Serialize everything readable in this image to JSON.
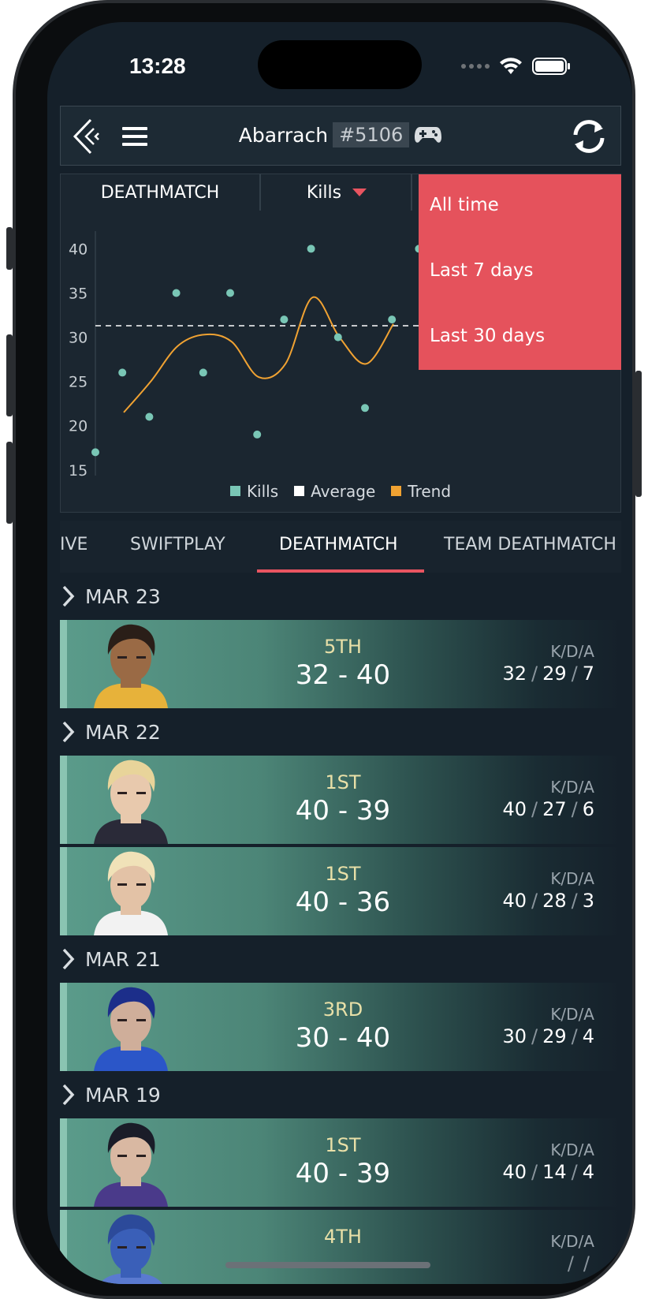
{
  "status": {
    "time": "13:28"
  },
  "header": {
    "player_name": "Abarrach",
    "player_tag": "#5106"
  },
  "filters": {
    "mode": "DEATHMATCH",
    "metric": "Kills"
  },
  "dropdown": {
    "items": [
      "All time",
      "Last 7 days",
      "Last 30 days"
    ]
  },
  "chart_data": {
    "type": "scatter",
    "y_ticks": [
      "40",
      "35",
      "30",
      "25",
      "20",
      "15"
    ],
    "ylim": [
      14,
      42
    ],
    "series": [
      {
        "name": "Kills",
        "color": "#79c6b5",
        "values": [
          17,
          26,
          21,
          35,
          26,
          35,
          19,
          32,
          40,
          30,
          22,
          32,
          40
        ]
      },
      {
        "name": "Average",
        "color": "#ffffff",
        "values": [
          31.3
        ]
      },
      {
        "name": "Trend",
        "color": "#f0a232",
        "values": [
          21.5,
          25,
          29,
          30.3,
          29.5,
          25.5,
          27,
          34.5,
          30,
          27,
          31.5
        ]
      }
    ],
    "legend": [
      "Kills",
      "Average",
      "Trend"
    ],
    "legend_position": "bottom"
  },
  "tabs": [
    "IVE",
    "SWIFTPLAY",
    "DEATHMATCH",
    "TEAM DEATHMATCH"
  ],
  "kda_label": "K/D/A",
  "groups": [
    {
      "date": "MAR 23",
      "matches": [
        {
          "place": "5TH",
          "score": "32 - 40",
          "k": "32",
          "d": "29",
          "a": "7"
        }
      ]
    },
    {
      "date": "MAR 22",
      "matches": [
        {
          "place": "1ST",
          "score": "40 - 39",
          "k": "40",
          "d": "27",
          "a": "6"
        },
        {
          "place": "1ST",
          "score": "40 - 36",
          "k": "40",
          "d": "28",
          "a": "3"
        }
      ]
    },
    {
      "date": "MAR 21",
      "matches": [
        {
          "place": "3RD",
          "score": "30 - 40",
          "k": "30",
          "d": "29",
          "a": "4"
        }
      ]
    },
    {
      "date": "MAR 19",
      "matches": [
        {
          "place": "1ST",
          "score": "40 - 39",
          "k": "40",
          "d": "14",
          "a": "4"
        },
        {
          "place": "4TH",
          "score": "",
          "k": "",
          "d": "",
          "a": ""
        }
      ]
    }
  ]
}
